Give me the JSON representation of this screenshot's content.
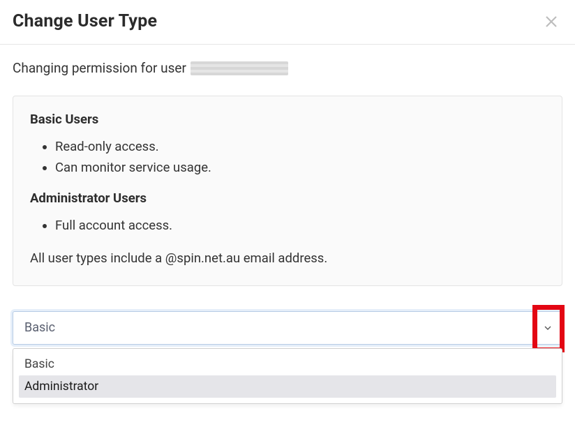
{
  "modal": {
    "title": "Change User Type"
  },
  "body": {
    "changing_prefix": "Changing permission for user"
  },
  "info": {
    "basic_heading": "Basic Users",
    "basic_items": {
      "0": "Read-only access.",
      "1": "Can monitor service usage."
    },
    "admin_heading": "Administrator Users",
    "admin_items": {
      "0": "Full account access."
    },
    "note": "All user types include a @spin.net.au email address."
  },
  "dropdown": {
    "selected": "Basic",
    "options": {
      "0": "Basic",
      "1": "Administrator"
    },
    "highlighted_index": 1
  }
}
